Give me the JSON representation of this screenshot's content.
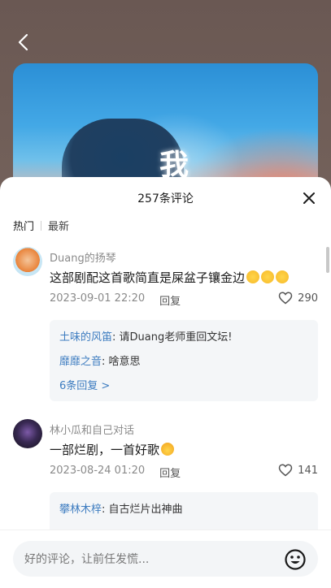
{
  "header": {
    "back_label": ""
  },
  "cover": {
    "title_char": "我"
  },
  "sheet": {
    "title": "257条评论",
    "tabs": [
      "热门",
      "最新"
    ]
  },
  "comments": [
    {
      "author": "Duang的扬琴",
      "text": "这部剧配这首歌简直是屎盆子镶金边",
      "emojis": [
        "smile-emoji",
        "smile-emoji",
        "smile-emoji"
      ],
      "date": "2023-09-01 22:20",
      "reply_label": "回复",
      "likes": "290",
      "replies": [
        {
          "author": "土味的风笛",
          "text": "请Duang老师重回文坛!"
        },
        {
          "author": "靡靡之音",
          "text": "啥意思"
        }
      ],
      "more_replies": "6条回复 >"
    },
    {
      "author": "林小瓜和自己对话",
      "text": "一部烂剧，一首好歌",
      "emojis": [
        "scream-emoji"
      ],
      "date": "2023-08-24 01:20",
      "reply_label": "回复",
      "likes": "141",
      "replies": [
        {
          "author": "攀林木梓",
          "text": "自古烂片出神曲"
        }
      ]
    }
  ],
  "input": {
    "placeholder": "好的评论，让前任发慌..."
  },
  "colors": {
    "accent_link": "#3d7cc0",
    "sheet_bg": "#ffffff",
    "backdrop": "#6f5d57"
  }
}
